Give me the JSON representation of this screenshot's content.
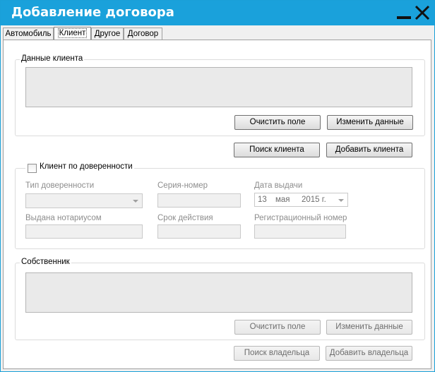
{
  "window": {
    "title": "Добавление договора"
  },
  "tabs": [
    {
      "label": "Автомобиль"
    },
    {
      "label": "Клиент"
    },
    {
      "label": "Другое"
    },
    {
      "label": "Договор"
    }
  ],
  "client_data": {
    "group_label": "Данные клиента",
    "clear_button": "Очистить поле",
    "edit_button": "Изменить данные"
  },
  "client_actions": {
    "search_button": "Поиск клиента",
    "add_button": "Добавить клиента"
  },
  "proxy": {
    "checkbox_label": "Клиент по доверенности",
    "checked": false,
    "type_label": "Тип доверенности",
    "type_value": "",
    "serial_label": "Серия-номер",
    "issue_date_label": "Дата выдачи",
    "issue_date": {
      "day": "13",
      "month": "мая",
      "year": "2015 г."
    },
    "notary_label": "Выдана нотариусом",
    "validity_label": "Срок действия",
    "reg_number_label": "Регистрационный номер"
  },
  "owner": {
    "group_label": "Собственник",
    "clear_button": "Очистить поле",
    "edit_button": "Изменить данные"
  },
  "owner_actions": {
    "search_button": "Поиск владельца",
    "add_button": "Добавить владельца"
  }
}
